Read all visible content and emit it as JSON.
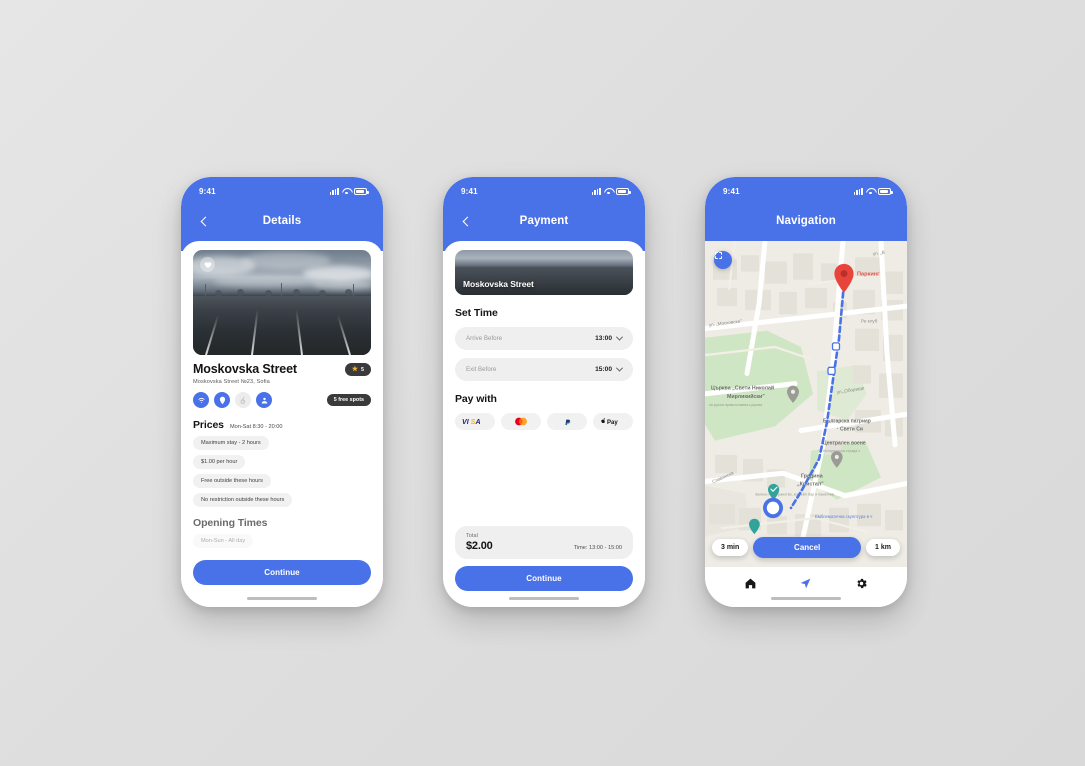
{
  "theme": {
    "accent": "#4a72e8",
    "dark_badge": "#3a3a3c",
    "star": "#f5b323",
    "chip_bg": "#f1f1f2",
    "canvas_bg": "#e3e3e3"
  },
  "status_bar": {
    "time": "9:41",
    "signal_icon": "signal-bars-icon",
    "wifi_icon": "wifi-icon",
    "battery_icon": "battery-icon"
  },
  "screens": [
    {
      "id": "details",
      "header": {
        "title": "Details",
        "back_icon": "chevron-left-icon"
      },
      "hero": {
        "favorite_icon": "heart-icon",
        "alt": "parking-lot-photo"
      },
      "place": {
        "name": "Moskovska Street",
        "address": "Moskovska Street №23, Sofia",
        "rating": "5",
        "rating_icon": "star-icon",
        "free_spots": "5 free spots"
      },
      "amenities": [
        {
          "name": "wifi-icon",
          "active": true
        },
        {
          "name": "ev-charger-icon",
          "active": true
        },
        {
          "name": "accessible-icon",
          "active": false
        },
        {
          "name": "attendant-icon",
          "active": true
        }
      ],
      "prices": {
        "title": "Prices",
        "subtitle": "Mon-Sat 8:30 - 20:00",
        "items": [
          "Maximum stay - 2 hours",
          "$1.00 per hour",
          "Free outside these hours",
          "No restriction outside these hours"
        ]
      },
      "opening": {
        "title": "Opening Times",
        "items": [
          "Mon-Sun - All day"
        ]
      },
      "cta": "Continue"
    },
    {
      "id": "payment",
      "header": {
        "title": "Payment",
        "back_icon": "chevron-left-icon"
      },
      "hero_label": "Moskovska Street",
      "set_time": {
        "title": "Set Time",
        "fields": [
          {
            "label": "Arrive Before",
            "value": "13:00",
            "chevron_icon": "chevron-down-icon"
          },
          {
            "label": "Exit Before",
            "value": "15:00",
            "chevron_icon": "chevron-down-icon"
          }
        ]
      },
      "pay_with": {
        "title": "Pay with",
        "methods": [
          {
            "name": "visa-icon",
            "label": "VISA"
          },
          {
            "name": "mastercard-icon",
            "label": "Mastercard"
          },
          {
            "name": "paypal-icon",
            "label": "PayPal"
          },
          {
            "name": "apple-pay-icon",
            "label": "Apple Pay"
          }
        ]
      },
      "total": {
        "label": "Total",
        "amount": "$2.00",
        "time": "Time: 13:00 - 15:00"
      },
      "cta": "Continue"
    },
    {
      "id": "navigation",
      "header": {
        "title": "Navigation"
      },
      "map": {
        "fullscreen_icon": "fullscreen-icon",
        "destination_label": "Паркинг",
        "destination_icon": "map-pin-icon",
        "user_location_icon": "current-location-icon",
        "labels": [
          "ул. „В",
          "ул. „Московска\"",
          "Ре клуб",
          "ул. „Оборище",
          "Църква „Свети Николай Мирликийски\"",
          "Руска православна църква",
          "Българска патриаршия - Свети Син",
          "Централен военен",
          "Историческа сграда с",
          "Градина „Кристал\"",
          "Зелено пространство, коктейл бар и паметник",
          "Славянска",
          "Емблематична скулптура в ч"
        ]
      },
      "eta": "3 min",
      "distance": "1 km",
      "cancel": "Cancel",
      "tabs": [
        {
          "name": "tab-home",
          "icon": "home-icon",
          "active": false
        },
        {
          "name": "tab-navigate",
          "icon": "navigation-arrow-icon",
          "active": true
        },
        {
          "name": "tab-settings",
          "icon": "gear-icon",
          "active": false
        }
      ]
    }
  ]
}
